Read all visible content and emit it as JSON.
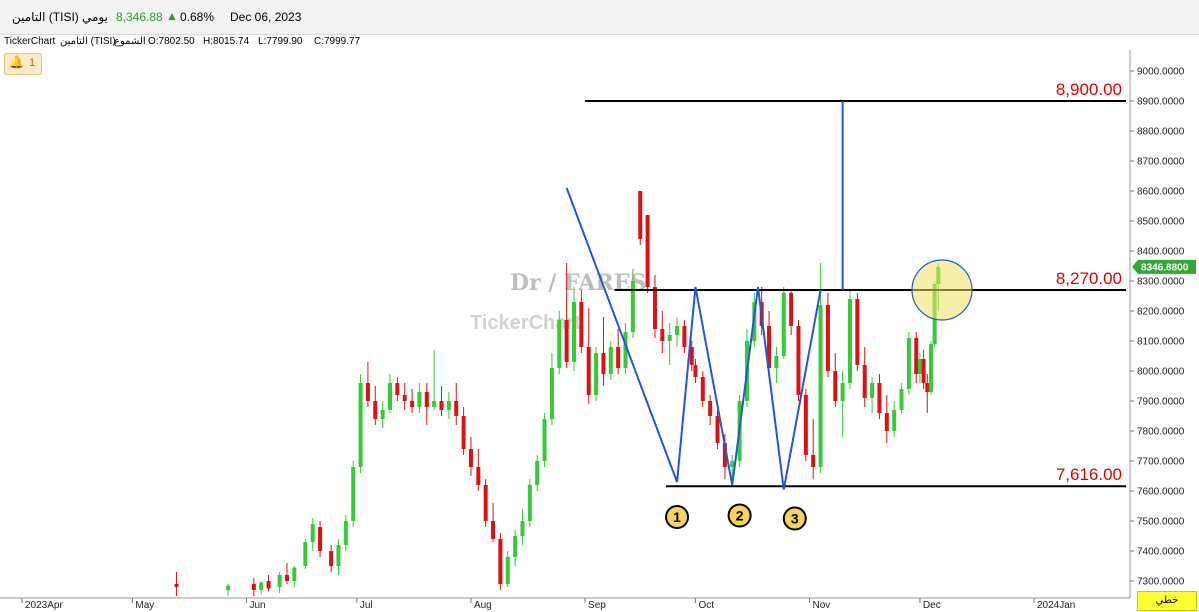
{
  "header": {
    "symbol": "التامين (TISI)",
    "period": "يومي",
    "last_price": "8,346.88",
    "change_icon": "up-triangle-icon",
    "change_pct": "0.68%",
    "date": "Dec 06, 2023"
  },
  "info": {
    "source": "TickerChart",
    "symbol": "التامين (TISI)",
    "series": "الشموع",
    "open": "O:7802.50",
    "high": "H:8015.74",
    "low": "L:7799.90",
    "close": "C:7999.77"
  },
  "alert": {
    "icon": "bell-icon",
    "count": "1"
  },
  "watermark": {
    "author": "Dr / FARES",
    "brand": "TickerChart"
  },
  "line_style_button": "خطي",
  "colors": {
    "up": "#33cc33",
    "down": "#dd1111",
    "trend": "#2255dd",
    "level": "#000000",
    "label": "#e00000",
    "highlight": "#f0e060",
    "last_price_bg": "#33aa33"
  },
  "chart_data": {
    "type": "candlestick",
    "ylim": [
      7250,
      9050
    ],
    "y_ticks": [
      "9000.0000",
      "8900.0000",
      "8800.0000",
      "8700.0000",
      "8600.0000",
      "8500.0000",
      "8400.0000",
      "8300.0000",
      "8200.0000",
      "8100.0000",
      "8000.0000",
      "7900.0000",
      "7800.0000",
      "7700.0000",
      "7600.0000",
      "7500.0000",
      "7400.0000",
      "7300.0000"
    ],
    "x_ticks": [
      {
        "label": "2023Apr",
        "date": "2023-04-01"
      },
      {
        "label": "May",
        "date": "2023-05-01"
      },
      {
        "label": "Jun",
        "date": "2023-06-01"
      },
      {
        "label": "Jul",
        "date": "2023-07-01"
      },
      {
        "label": "Aug",
        "date": "2023-08-01"
      },
      {
        "label": "Sep",
        "date": "2023-09-01"
      },
      {
        "label": "Oct",
        "date": "2023-10-01"
      },
      {
        "label": "Nov",
        "date": "2023-11-01"
      },
      {
        "label": "Dec",
        "date": "2023-12-01"
      },
      {
        "label": "2024Jan",
        "date": "2024-01-01"
      }
    ],
    "last_price_label": "8346.8800",
    "levels": [
      {
        "value": 8900,
        "label": "8,900.00",
        "from": "2023-09-01"
      },
      {
        "value": 8270,
        "label": "8,270.00",
        "from": "2023-09-09"
      },
      {
        "value": 7616,
        "label": "7,616.00",
        "from": "2023-09-23"
      }
    ],
    "trendlines": [
      [
        [
          "2023-08-27",
          8610
        ],
        [
          "2023-09-26",
          7630
        ],
        [
          "2023-10-01",
          8280
        ],
        [
          "2023-10-11",
          7620
        ],
        [
          "2023-10-18",
          8280
        ],
        [
          "2023-10-25",
          7605
        ],
        [
          "2023-11-04",
          8270
        ]
      ],
      [
        [
          "2023-11-10",
          8270
        ],
        [
          "2023-11-10",
          8900
        ]
      ]
    ],
    "markers": [
      {
        "label": "1",
        "date": "2023-09-26",
        "value": 7580
      },
      {
        "label": "2",
        "date": "2023-10-13",
        "value": 7585
      },
      {
        "label": "3",
        "date": "2023-10-28",
        "value": 7575
      }
    ],
    "highlight": {
      "date": "2023-12-07",
      "value": 8270
    },
    "candles": [
      {
        "date": "2023-05-13",
        "open": 7290,
        "high": 7330,
        "low": 7250,
        "close": 7280
      },
      {
        "date": "2023-05-27",
        "open": 7270,
        "high": 7290,
        "low": 7250,
        "close": 7285
      },
      {
        "date": "2023-06-03",
        "open": 7290,
        "high": 7310,
        "low": 7250,
        "close": 7270
      },
      {
        "date": "2023-06-05",
        "open": 7270,
        "high": 7300,
        "low": 7255,
        "close": 7295
      },
      {
        "date": "2023-06-07",
        "open": 7300,
        "high": 7320,
        "low": 7265,
        "close": 7275
      },
      {
        "date": "2023-06-10",
        "open": 7280,
        "high": 7330,
        "low": 7260,
        "close": 7320
      },
      {
        "date": "2023-06-12",
        "open": 7320,
        "high": 7360,
        "low": 7290,
        "close": 7300
      },
      {
        "date": "2023-06-14",
        "open": 7300,
        "high": 7350,
        "low": 7280,
        "close": 7345
      },
      {
        "date": "2023-06-17",
        "open": 7350,
        "high": 7440,
        "low": 7340,
        "close": 7430
      },
      {
        "date": "2023-06-19",
        "open": 7430,
        "high": 7510,
        "low": 7400,
        "close": 7490
      },
      {
        "date": "2023-06-21",
        "open": 7480,
        "high": 7500,
        "low": 7380,
        "close": 7400
      },
      {
        "date": "2023-06-24",
        "open": 7400,
        "high": 7420,
        "low": 7330,
        "close": 7350
      },
      {
        "date": "2023-06-26",
        "open": 7350,
        "high": 7440,
        "low": 7320,
        "close": 7420
      },
      {
        "date": "2023-06-28",
        "open": 7420,
        "high": 7520,
        "low": 7400,
        "close": 7500
      },
      {
        "date": "2023-06-30",
        "open": 7500,
        "high": 7700,
        "low": 7480,
        "close": 7680
      },
      {
        "date": "2023-07-02",
        "open": 7680,
        "high": 7990,
        "low": 7660,
        "close": 7960
      },
      {
        "date": "2023-07-04",
        "open": 7960,
        "high": 8030,
        "low": 7880,
        "close": 7900
      },
      {
        "date": "2023-07-06",
        "open": 7900,
        "high": 7950,
        "low": 7820,
        "close": 7840
      },
      {
        "date": "2023-07-08",
        "open": 7840,
        "high": 7900,
        "low": 7810,
        "close": 7870
      },
      {
        "date": "2023-07-10",
        "open": 7870,
        "high": 7990,
        "low": 7860,
        "close": 7960
      },
      {
        "date": "2023-07-12",
        "open": 7960,
        "high": 7980,
        "low": 7900,
        "close": 7920
      },
      {
        "date": "2023-07-14",
        "open": 7920,
        "high": 7960,
        "low": 7870,
        "close": 7900
      },
      {
        "date": "2023-07-16",
        "open": 7900,
        "high": 7940,
        "low": 7860,
        "close": 7880
      },
      {
        "date": "2023-07-18",
        "open": 7880,
        "high": 7960,
        "low": 7860,
        "close": 7930
      },
      {
        "date": "2023-07-20",
        "open": 7930,
        "high": 7960,
        "low": 7820,
        "close": 7880
      },
      {
        "date": "2023-07-22",
        "open": 7880,
        "high": 8070,
        "low": 7870,
        "close": 7900
      },
      {
        "date": "2023-07-24",
        "open": 7900,
        "high": 7950,
        "low": 7850,
        "close": 7870
      },
      {
        "date": "2023-07-26",
        "open": 7870,
        "high": 7930,
        "low": 7840,
        "close": 7900
      },
      {
        "date": "2023-07-28",
        "open": 7900,
        "high": 7960,
        "low": 7820,
        "close": 7850
      },
      {
        "date": "2023-07-30",
        "open": 7850,
        "high": 7880,
        "low": 7720,
        "close": 7740
      },
      {
        "date": "2023-08-01",
        "open": 7740,
        "high": 7780,
        "low": 7650,
        "close": 7680
      },
      {
        "date": "2023-08-03",
        "open": 7680,
        "high": 7740,
        "low": 7600,
        "close": 7620
      },
      {
        "date": "2023-08-05",
        "open": 7620,
        "high": 7640,
        "low": 7480,
        "close": 7500
      },
      {
        "date": "2023-08-07",
        "open": 7500,
        "high": 7560,
        "low": 7430,
        "close": 7440
      },
      {
        "date": "2023-08-09",
        "open": 7440,
        "high": 7460,
        "low": 7270,
        "close": 7290
      },
      {
        "date": "2023-08-11",
        "open": 7290,
        "high": 7400,
        "low": 7280,
        "close": 7380
      },
      {
        "date": "2023-08-13",
        "open": 7380,
        "high": 7470,
        "low": 7350,
        "close": 7450
      },
      {
        "date": "2023-08-15",
        "open": 7450,
        "high": 7540,
        "low": 7420,
        "close": 7500
      },
      {
        "date": "2023-08-17",
        "open": 7500,
        "high": 7640,
        "low": 7480,
        "close": 7620
      },
      {
        "date": "2023-08-19",
        "open": 7620,
        "high": 7720,
        "low": 7600,
        "close": 7700
      },
      {
        "date": "2023-08-21",
        "open": 7700,
        "high": 7860,
        "low": 7680,
        "close": 7840
      },
      {
        "date": "2023-08-23",
        "open": 7840,
        "high": 8060,
        "low": 7820,
        "close": 8010
      },
      {
        "date": "2023-08-25",
        "open": 8010,
        "high": 8200,
        "low": 7990,
        "close": 8170
      },
      {
        "date": "2023-08-27",
        "open": 8170,
        "high": 8360,
        "low": 8010,
        "close": 8030
      },
      {
        "date": "2023-08-29",
        "open": 8030,
        "high": 8280,
        "low": 8000,
        "close": 8230
      },
      {
        "date": "2023-08-31",
        "open": 8230,
        "high": 8270,
        "low": 8060,
        "close": 8080
      },
      {
        "date": "2023-09-02",
        "open": 8080,
        "high": 8210,
        "low": 7890,
        "close": 7920
      },
      {
        "date": "2023-09-04",
        "open": 7920,
        "high": 8080,
        "low": 7900,
        "close": 8060
      },
      {
        "date": "2023-09-06",
        "open": 8060,
        "high": 8180,
        "low": 7950,
        "close": 7990
      },
      {
        "date": "2023-09-08",
        "open": 7990,
        "high": 8100,
        "low": 7970,
        "close": 8080
      },
      {
        "date": "2023-09-10",
        "open": 8080,
        "high": 8140,
        "low": 7990,
        "close": 8010
      },
      {
        "date": "2023-09-12",
        "open": 8010,
        "high": 8160,
        "low": 7990,
        "close": 8130
      },
      {
        "date": "2023-09-14",
        "open": 8130,
        "high": 8340,
        "low": 8110,
        "close": 8300
      },
      {
        "date": "2023-09-16",
        "open": 8600,
        "high": 8600,
        "low": 8420,
        "close": 8440
      },
      {
        "date": "2023-09-18",
        "open": 8520,
        "high": 8520,
        "low": 8260,
        "close": 8280
      },
      {
        "date": "2023-09-20",
        "open": 8280,
        "high": 8320,
        "low": 8110,
        "close": 8140
      },
      {
        "date": "2023-09-22",
        "open": 8140,
        "high": 8200,
        "low": 8060,
        "close": 8100
      },
      {
        "date": "2023-09-24",
        "open": 8100,
        "high": 8160,
        "low": 8020,
        "close": 8120
      },
      {
        "date": "2023-09-26",
        "open": 8120,
        "high": 8180,
        "low": 8080,
        "close": 8150
      },
      {
        "date": "2023-09-28",
        "open": 8150,
        "high": 8170,
        "low": 8060,
        "close": 8080
      },
      {
        "date": "2023-09-30",
        "open": 8080,
        "high": 8100,
        "low": 8000,
        "close": 8020
      },
      {
        "date": "2023-10-01",
        "open": 8020,
        "high": 8040,
        "low": 7960,
        "close": 7980
      },
      {
        "date": "2023-10-03",
        "open": 7980,
        "high": 8000,
        "low": 7880,
        "close": 7900
      },
      {
        "date": "2023-10-05",
        "open": 7900,
        "high": 7920,
        "low": 7820,
        "close": 7850
      },
      {
        "date": "2023-10-07",
        "open": 7850,
        "high": 7870,
        "low": 7740,
        "close": 7760
      },
      {
        "date": "2023-10-09",
        "open": 7760,
        "high": 7790,
        "low": 7640,
        "close": 7680
      },
      {
        "date": "2023-10-11",
        "open": 7680,
        "high": 7720,
        "low": 7620,
        "close": 7700
      },
      {
        "date": "2023-10-13",
        "open": 7700,
        "high": 7920,
        "low": 7680,
        "close": 7900
      },
      {
        "date": "2023-10-15",
        "open": 7900,
        "high": 8140,
        "low": 7880,
        "close": 8100
      },
      {
        "date": "2023-10-17",
        "open": 8100,
        "high": 8260,
        "low": 8080,
        "close": 8230
      },
      {
        "date": "2023-10-19",
        "open": 8230,
        "high": 8280,
        "low": 8120,
        "close": 8150
      },
      {
        "date": "2023-10-21",
        "open": 8150,
        "high": 8200,
        "low": 7990,
        "close": 8010
      },
      {
        "date": "2023-10-23",
        "open": 8010,
        "high": 8080,
        "low": 7960,
        "close": 8050
      },
      {
        "date": "2023-10-25",
        "open": 8050,
        "high": 8280,
        "low": 8040,
        "close": 8260
      },
      {
        "date": "2023-10-27",
        "open": 8260,
        "high": 8270,
        "low": 8120,
        "close": 8150
      },
      {
        "date": "2023-10-29",
        "open": 8150,
        "high": 8170,
        "low": 7900,
        "close": 7920
      },
      {
        "date": "2023-10-31",
        "open": 7920,
        "high": 7940,
        "low": 7700,
        "close": 7720
      },
      {
        "date": "2023-11-02",
        "open": 7720,
        "high": 7840,
        "low": 7640,
        "close": 7680
      },
      {
        "date": "2023-11-04",
        "open": 7680,
        "high": 8360,
        "low": 7660,
        "close": 8220
      },
      {
        "date": "2023-11-06",
        "open": 8220,
        "high": 8260,
        "low": 7980,
        "close": 8000
      },
      {
        "date": "2023-11-08",
        "open": 8000,
        "high": 8060,
        "low": 7880,
        "close": 7900
      },
      {
        "date": "2023-11-10",
        "open": 7900,
        "high": 8000,
        "low": 7780,
        "close": 7960
      },
      {
        "date": "2023-11-12",
        "open": 7960,
        "high": 8270,
        "low": 7940,
        "close": 8240
      },
      {
        "date": "2023-11-14",
        "open": 8240,
        "high": 8260,
        "low": 8000,
        "close": 8020
      },
      {
        "date": "2023-11-16",
        "open": 8020,
        "high": 8080,
        "low": 7880,
        "close": 7910
      },
      {
        "date": "2023-11-18",
        "open": 7910,
        "high": 7980,
        "low": 7860,
        "close": 7960
      },
      {
        "date": "2023-11-20",
        "open": 7960,
        "high": 7990,
        "low": 7840,
        "close": 7860
      },
      {
        "date": "2023-11-22",
        "open": 7860,
        "high": 7920,
        "low": 7760,
        "close": 7800
      },
      {
        "date": "2023-11-24",
        "open": 7800,
        "high": 7900,
        "low": 7780,
        "close": 7870
      },
      {
        "date": "2023-11-26",
        "open": 7870,
        "high": 7960,
        "low": 7860,
        "close": 7940
      },
      {
        "date": "2023-11-28",
        "open": 7940,
        "high": 8130,
        "low": 7920,
        "close": 8110
      },
      {
        "date": "2023-11-30",
        "open": 8110,
        "high": 8130,
        "low": 7960,
        "close": 7990
      },
      {
        "date": "2023-12-01",
        "open": 7990,
        "high": 8060,
        "low": 7960,
        "close": 8040
      },
      {
        "date": "2023-12-02",
        "open": 8040,
        "high": 8070,
        "low": 7940,
        "close": 7960
      },
      {
        "date": "2023-12-03",
        "open": 7960,
        "high": 7990,
        "low": 7860,
        "close": 7930
      },
      {
        "date": "2023-12-04",
        "open": 7930,
        "high": 8100,
        "low": 7920,
        "close": 8090
      },
      {
        "date": "2023-12-05",
        "open": 8090,
        "high": 8300,
        "low": 8080,
        "close": 8290
      },
      {
        "date": "2023-12-06",
        "open": 8290,
        "high": 8360,
        "low": 8200,
        "close": 8346.88
      }
    ]
  }
}
